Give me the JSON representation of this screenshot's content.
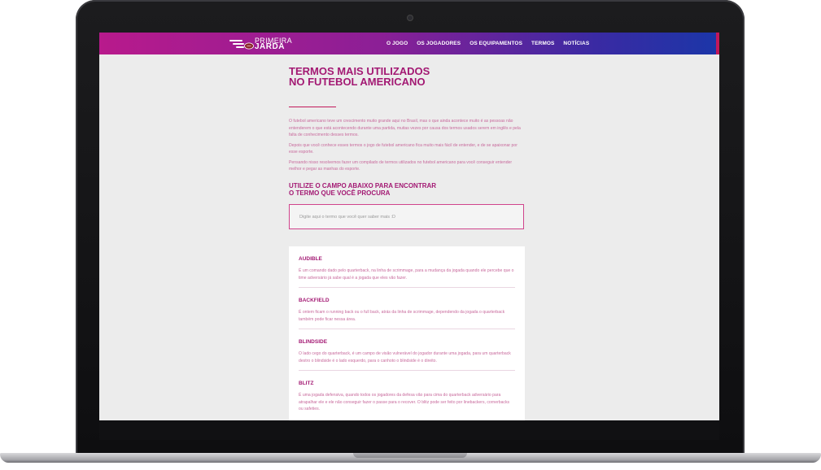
{
  "nav": {
    "logo_line1": "PRIMEIRA",
    "logo_line2": "JARDA",
    "items": [
      "O JOGO",
      "OS JOGADORES",
      "OS EQUIPAMENTOS",
      "TERMOS",
      "NOTÍCIAS"
    ]
  },
  "page": {
    "title_line1": "TERMOS MAIS UTILIZADOS",
    "title_line2": "NO FUTEBOL AMERICANO",
    "intro": [
      "O futebol americano teve um crescimento muito grande aqui no Brasil, mas o que ainda acontece muito é as pessoas não entenderem o que está acontecendo durante uma partida, muitas vezes por causa dos termos usados serem em inglês e pela falta de conhecimento desses termos.",
      "Depois que você conhece esses termos o jogo de futebol americano fica muito mais fácil de entender, e de se apaixonar por esse esporte.",
      "Pensando nisso resolvemos fazer um compilado de termos utilizados no futebol americano para você conseguir entender melhor e pegar as manhas do esporte."
    ],
    "subtitle_line1": "UTILIZE O CAMPO ABAIXO PARA ENCONTRAR",
    "subtitle_line2": "O TERMO QUE VOCÊ PROCURA"
  },
  "search": {
    "placeholder": "Digite aqui o termo que você quer saber mais :D"
  },
  "terms": [
    {
      "title": "AUDIBLE",
      "desc": "É um comando dado pelo quarterback, na linha de scrimmage, para a mudança da jogada quando ele percebe que o time adversário já sabe qual é a jogada que eles vão fazer."
    },
    {
      "title": "BACKFIELD",
      "desc": "É ontem ficam o running back ou o full back, atrás da linha de scrimmage, dependendo da jogada o quarterback também pode ficar nessa área."
    },
    {
      "title": "BLINDSIDE",
      "desc": "O lado cego do quarterback, é um campo de visão vulnerável do jogador durante uma jogada, para um quarterback destro o blindside é o lado esquerdo, para o canhoto o blindside é o direito."
    },
    {
      "title": "BLITZ",
      "desc": "É uma jogada defensiva, quando todos os jogadores da defesa vão para cima do quarterback adversário para atrapalhar ele e ele não conseguir fazer o passe para o recover. O blitz pode ser feito por linebackers, cornerbacks ou safeties."
    }
  ]
}
